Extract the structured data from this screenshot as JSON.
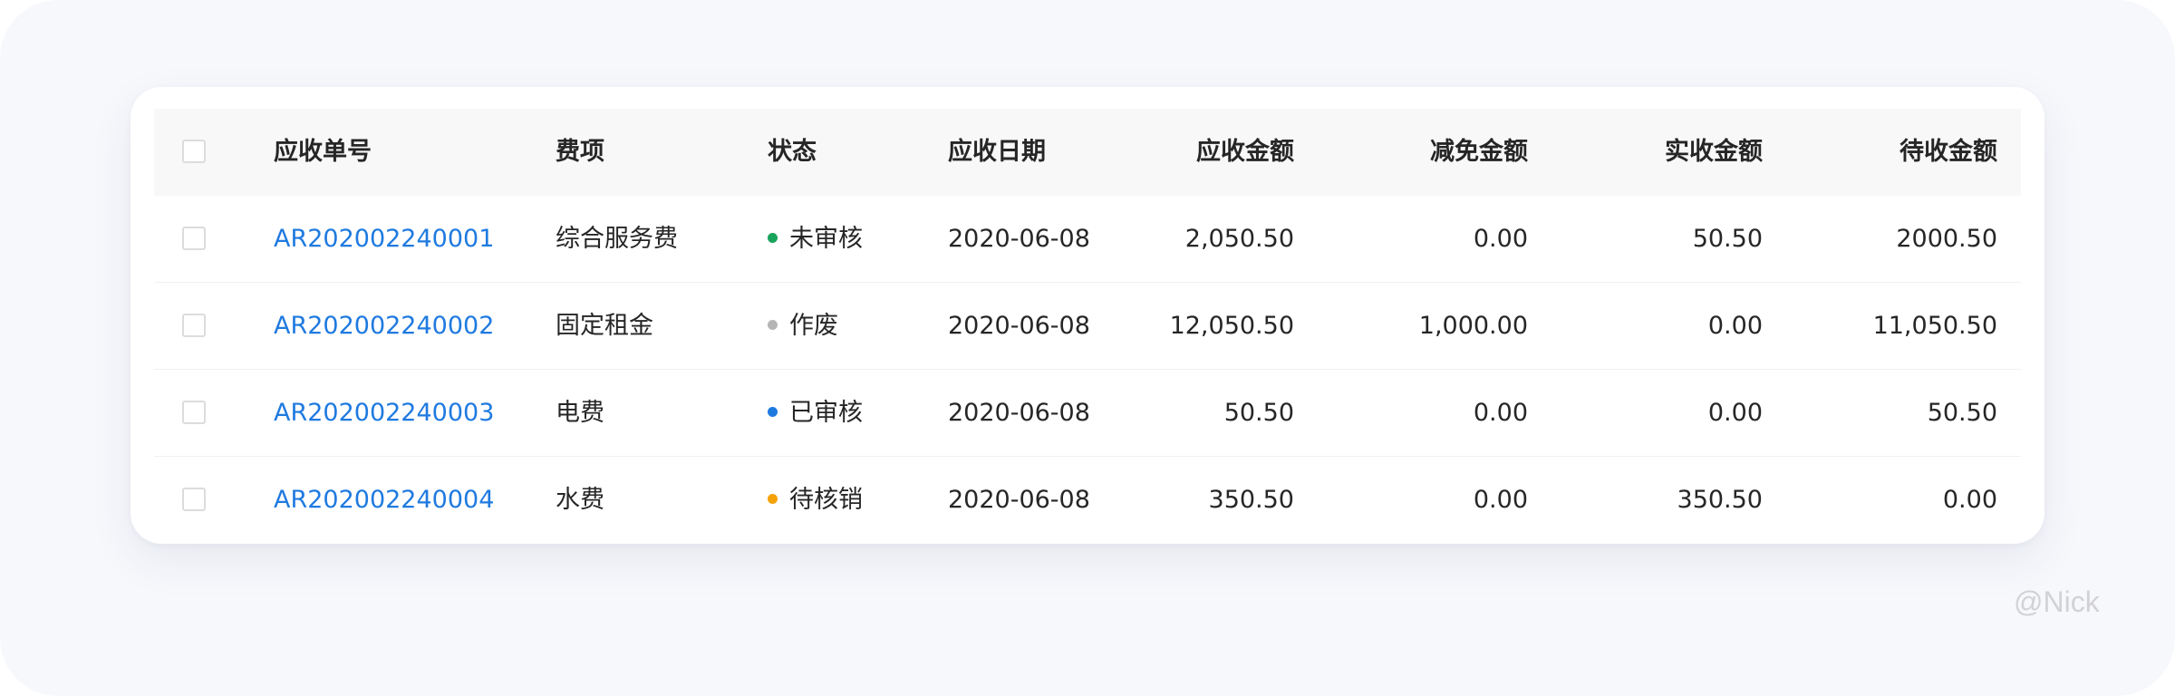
{
  "table": {
    "headers": {
      "id": "应收单号",
      "fee": "费项",
      "status": "状态",
      "date": "应收日期",
      "due": "应收金额",
      "reduce": "减免金额",
      "paid": "实收金额",
      "pending": "待收金额"
    },
    "rows": [
      {
        "id": "AR202002240001",
        "fee": "综合服务费",
        "status": "未审核",
        "status_color": "#1aa35b",
        "date": "2020-06-08",
        "due": "2,050.50",
        "reduce": "0.00",
        "paid": "50.50",
        "pending": "2000.50"
      },
      {
        "id": "AR202002240002",
        "fee": "固定租金",
        "status": "作废",
        "status_color": "#b5b5b5",
        "date": "2020-06-08",
        "due": "12,050.50",
        "reduce": "1,000.00",
        "paid": "0.00",
        "pending": "11,050.50"
      },
      {
        "id": "AR202002240003",
        "fee": "电费",
        "status": "已审核",
        "status_color": "#1f7ae0",
        "date": "2020-06-08",
        "due": "50.50",
        "reduce": "0.00",
        "paid": "0.00",
        "pending": "50.50"
      },
      {
        "id": "AR202002240004",
        "fee": "水费",
        "status": "待核销",
        "status_color": "#f5a20a",
        "date": "2020-06-08",
        "due": "350.50",
        "reduce": "0.00",
        "paid": "350.50",
        "pending": "0.00"
      }
    ]
  },
  "watermark": "@Nick"
}
